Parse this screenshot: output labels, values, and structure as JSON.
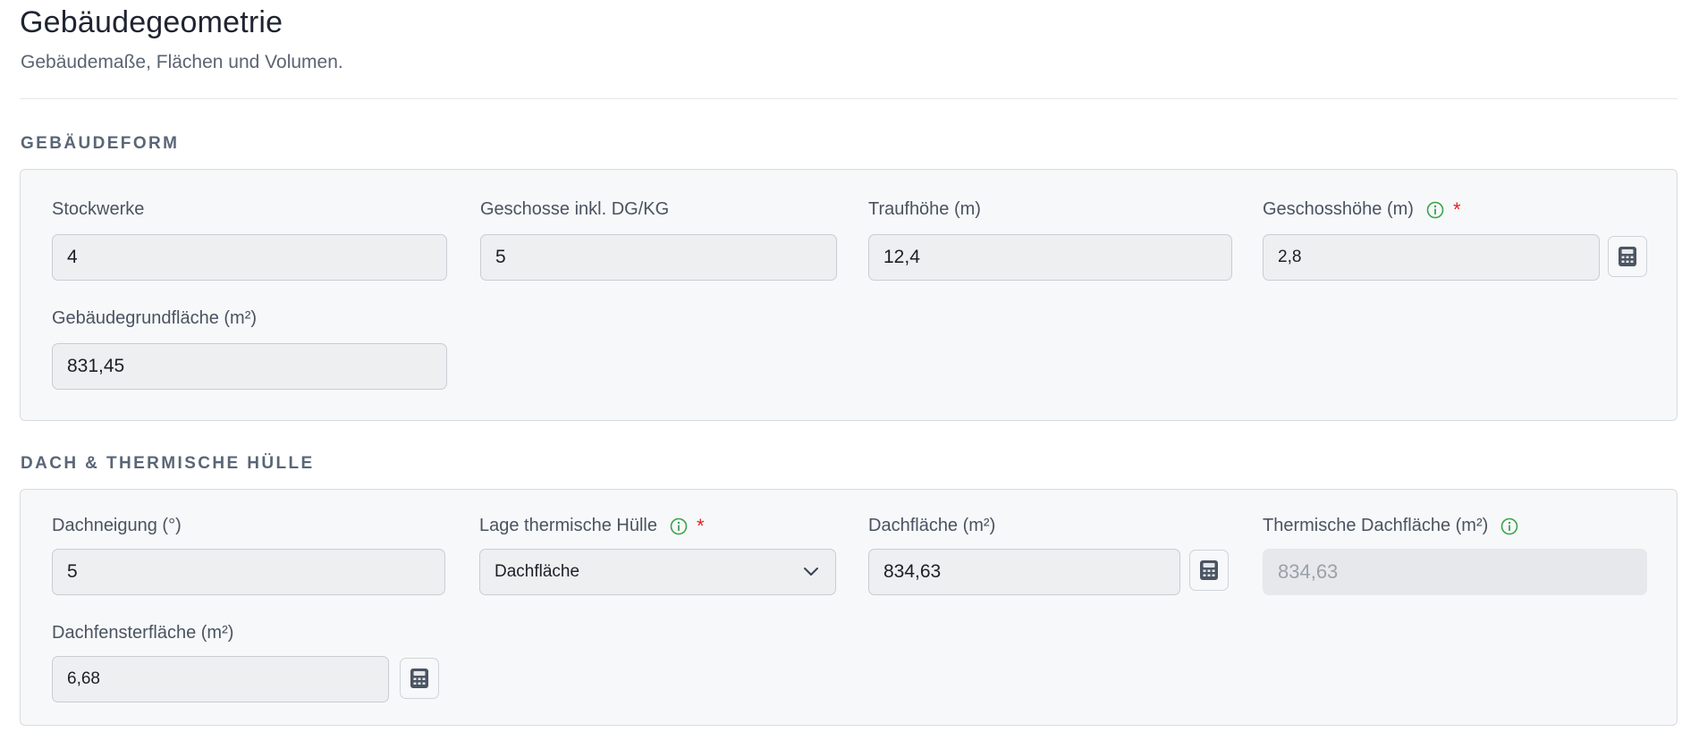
{
  "header": {
    "title": "Gebäudegeometrie",
    "subtitle": "Gebäudemaße, Flächen und Volumen."
  },
  "sections": {
    "form": {
      "title": "GEBÄUDEFORM",
      "fields": {
        "stockwerke": {
          "label": "Stockwerke",
          "value": "4"
        },
        "geschosse": {
          "label": "Geschosse inkl. DG/KG",
          "value": "5"
        },
        "traufhoehe": {
          "label": "Traufhöhe (m)",
          "value": "12,4"
        },
        "geschosshoehe": {
          "label": "Geschosshöhe (m)",
          "value": "2,8",
          "required": "*"
        },
        "grundflaeche": {
          "label": "Gebäudegrundfläche (m²)",
          "value": "831,45"
        }
      }
    },
    "roof": {
      "title": "DACH & THERMISCHE HÜLLE",
      "fields": {
        "dachneigung": {
          "label": "Dachneigung (°)",
          "value": "5"
        },
        "lage": {
          "label": "Lage thermische Hülle",
          "value": "Dachfläche",
          "required": "*"
        },
        "dachflaeche": {
          "label": "Dachfläche (m²)",
          "value": "834,63"
        },
        "thermisch": {
          "label": "Thermische Dachfläche (m²)",
          "value": "834,63"
        },
        "dachfenster": {
          "label": "Dachfensterfläche (m²)",
          "value": "6,68"
        }
      }
    }
  },
  "icons": {
    "info": "info-circle-icon",
    "calculator": "calculator-icon",
    "chevron": "chevron-down-icon"
  },
  "colors": {
    "info_green": "#3aa34a",
    "required_red": "#e02424",
    "icon_gray": "#4b5563"
  }
}
